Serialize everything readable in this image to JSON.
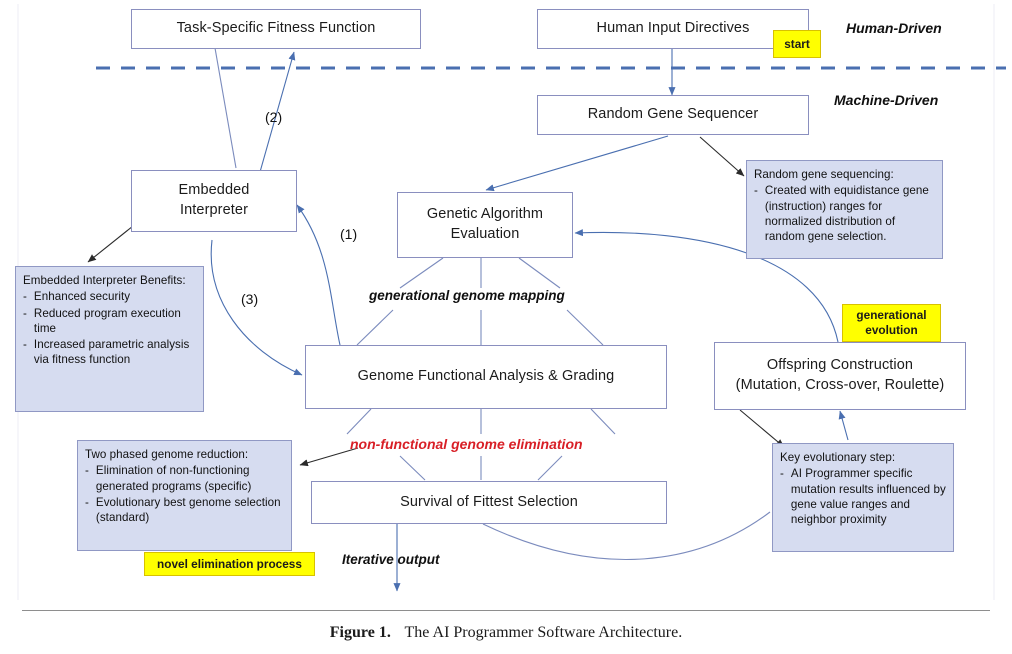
{
  "figure": {
    "caption_label": "Figure 1.",
    "caption_text": "The AI Programmer Software Architecture."
  },
  "lanes": {
    "human": "Human-Driven",
    "machine": "Machine-Driven"
  },
  "nodes": {
    "fitness_function": "Task-Specific Fitness Function",
    "human_input": "Human Input Directives",
    "random_sequencer": "Random Gene Sequencer",
    "embedded_interpreter": "Embedded\nInterpreter",
    "ga_evaluation": "Genetic Algorithm\nEvaluation",
    "genome_analysis": "Genome Functional Analysis & Grading",
    "offspring_construction": "Offspring Construction\n(Mutation, Cross-over, Roulette)",
    "survival_selection": "Survival of Fittest Selection"
  },
  "badges": {
    "start": "start",
    "generational_evolution": "generational\nevolution",
    "novel_elimination": "novel elimination process"
  },
  "edge_labels": {
    "one": "(1)",
    "two": "(2)",
    "three": "(3)",
    "generational_genome_mapping": "generational genome mapping",
    "non_functional_elimination": "non-functional genome elimination",
    "iterative_output": "Iterative output"
  },
  "notes": {
    "random_gene": {
      "title": "Random gene sequencing:",
      "bullets": [
        "Created with equidistance gene (instruction) ranges for normalized distribution of random gene selection."
      ]
    },
    "embedded_interpreter": {
      "title": "Embedded Interpreter Benefits:",
      "bullets": [
        "Enhanced security",
        "Reduced program execution time",
        "Increased parametric analysis via fitness function"
      ]
    },
    "genome_reduction": {
      "title": "Two phased genome reduction:",
      "bullets": [
        "Elimination of non-functioning generated programs (specific)",
        "Evolutionary best genome selection (standard)"
      ]
    },
    "key_evolutionary": {
      "title": "Key evolutionary step:",
      "bullets": [
        "AI Programmer specific mutation results influenced by gene value ranges and neighbor proximity"
      ]
    }
  },
  "colors": {
    "box_border": "#8a8fbf",
    "note_fill": "#d6dcf0",
    "badge_fill": "#ffff00",
    "arrow": "#4a6fb0",
    "accent_red": "#d81f26",
    "divider": "#4a6fb0"
  }
}
